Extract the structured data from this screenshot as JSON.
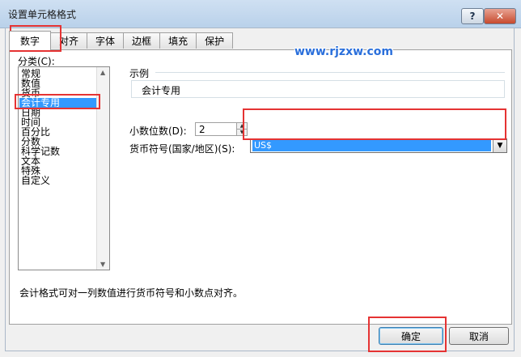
{
  "window": {
    "title": "设置单元格格式",
    "help": "?",
    "close": "✕"
  },
  "tabs": [
    {
      "label": "数字",
      "active": true
    },
    {
      "label": "对齐"
    },
    {
      "label": "字体"
    },
    {
      "label": "边框"
    },
    {
      "label": "填充"
    },
    {
      "label": "保护"
    }
  ],
  "watermark": "www.rjzxw.com",
  "category": {
    "label": "分类(C):",
    "items": [
      "常规",
      "数值",
      "货币",
      "会计专用",
      "日期",
      "时间",
      "百分比",
      "分数",
      "科学记数",
      "文本",
      "特殊",
      "自定义"
    ],
    "selected": "会计专用"
  },
  "sample": {
    "label": "示例",
    "value": "会计专用"
  },
  "decimal": {
    "label": "小数位数(D):",
    "value": "2"
  },
  "currency": {
    "label": "货币符号(国家/地区)(S):",
    "value": "US$"
  },
  "description": "会计格式可对一列数值进行货币符号和小数点对齐。",
  "buttons": {
    "ok": "确定",
    "cancel": "取消"
  },
  "colors": {
    "selection": "#3399ff",
    "highlight": "#e53333",
    "watermark": "#2a6fdb"
  }
}
